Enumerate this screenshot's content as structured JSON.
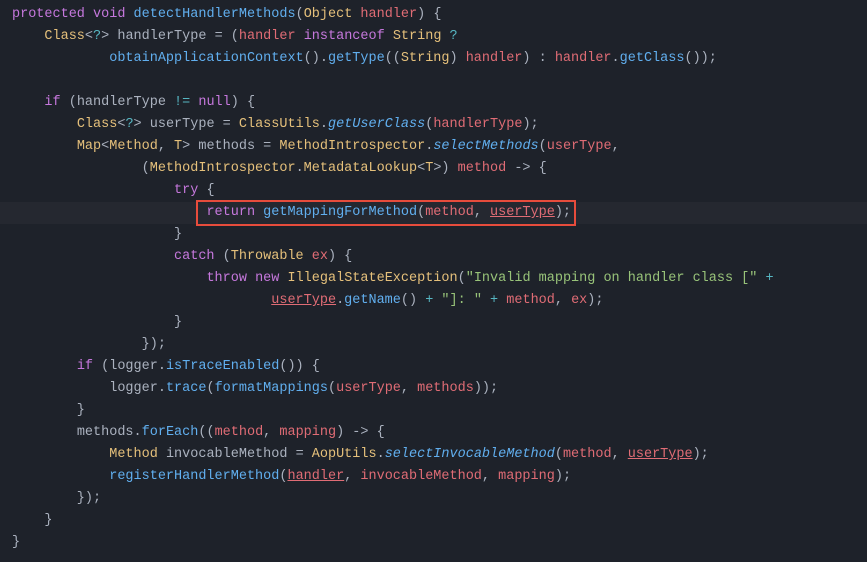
{
  "code": {
    "l1": {
      "kw1": "protected",
      "kw2": "void",
      "method": "detectHandlerMethods",
      "type": "Object",
      "param": "handler",
      "tail": ") {"
    },
    "l2": {
      "indent": "    ",
      "type1": "Class",
      "punc1": "<",
      "op": "?",
      "punc2": "> ",
      "var": "handlerType",
      "eq": " = (",
      "param": "handler",
      "kw": " instanceof ",
      "type2": "String",
      "tail": " ?"
    },
    "l3": {
      "indent": "            ",
      "call": "obtainApplicationContext",
      "p1": "().",
      "call2": "getType",
      "p2": "((",
      "type": "String",
      "p3": ") ",
      "param": "handler",
      "p4": ") : ",
      "param2": "handler",
      "p5": ".",
      "call3": "getClass",
      "tail": "());"
    },
    "l5": {
      "indent": "    ",
      "kw": "if",
      "p1": " (",
      "var": "handlerType",
      "op": " != ",
      "kw2": "null",
      "tail": ") {"
    },
    "l6": {
      "indent": "        ",
      "type1": "Class",
      "p1": "<",
      "op": "?",
      "p2": "> ",
      "var": "userType",
      "eq": " = ",
      "type2": "ClassUtils",
      "p3": ".",
      "ital": "getUserClass",
      "p4": "(",
      "param": "handlerType",
      "tail": ");"
    },
    "l7": {
      "indent": "        ",
      "type1": "Map",
      "p1": "<",
      "type2": "Method",
      "p2": ", ",
      "type3": "T",
      "p3": "> ",
      "var": "methods",
      "eq": " = ",
      "type4": "MethodIntrospector",
      "p4": ".",
      "ital": "selectMethods",
      "p5": "(",
      "param": "userType",
      "tail": ","
    },
    "l8": {
      "indent": "                (",
      "type1": "MethodIntrospector",
      "p1": ".",
      "type2": "MetadataLookup",
      "p2": "<",
      "type3": "T",
      "p3": ">) ",
      "param": "method",
      "arrow": " -> {",
      "tail": ""
    },
    "l9": {
      "indent": "                    ",
      "kw": "try",
      "tail": " {"
    },
    "l10": {
      "indent": "                        ",
      "kw": "return",
      "sp": " ",
      "call": "getMappingForMethod",
      "p1": "(",
      "param1": "method",
      "p2": ", ",
      "uvar": "userType",
      "tail": ");"
    },
    "l11": {
      "indent": "                    }",
      "tail": ""
    },
    "l12": {
      "indent": "                    ",
      "kw": "catch",
      "p1": " (",
      "type": "Throwable",
      "sp": " ",
      "param": "ex",
      "tail": ") {"
    },
    "l13": {
      "indent": "                        ",
      "kw1": "throw",
      "sp": " ",
      "kw2": "new",
      "sp2": " ",
      "type": "IllegalStateException",
      "p1": "(",
      "str": "\"Invalid mapping on handler class [\"",
      "op": " +",
      "tail": ""
    },
    "l14": {
      "indent": "                                ",
      "uvar": "userType",
      "p1": ".",
      "call": "getName",
      "p2": "() ",
      "op1": "+",
      "sp": " ",
      "str": "\"]: \"",
      "sp2": " ",
      "op2": "+",
      "sp3": " ",
      "param1": "method",
      "p3": ", ",
      "param2": "ex",
      "tail": ");"
    },
    "l15": {
      "indent": "                    }",
      "tail": ""
    },
    "l16": {
      "indent": "                });",
      "tail": ""
    },
    "l17": {
      "indent": "        ",
      "kw": "if",
      "p1": " (",
      "var": "logger",
      "p2": ".",
      "call": "isTraceEnabled",
      "tail": "()) {"
    },
    "l18": {
      "indent": "            ",
      "var": "logger",
      "p1": ".",
      "call1": "trace",
      "p2": "(",
      "call2": "formatMappings",
      "p3": "(",
      "param1": "userType",
      "p4": ", ",
      "param2": "methods",
      "tail": "));"
    },
    "l19": {
      "indent": "        }",
      "tail": ""
    },
    "l20": {
      "indent": "        ",
      "var": "methods",
      "p1": ".",
      "call": "forEach",
      "p2": "((",
      "param1": "method",
      "p3": ", ",
      "param2": "mapping",
      "arrow": ") -> {",
      "tail": ""
    },
    "l21": {
      "indent": "            ",
      "type1": "Method",
      "sp": " ",
      "var": "invocableMethod",
      "eq": " = ",
      "type2": "AopUtils",
      "p1": ".",
      "ital": "selectInvocableMethod",
      "p2": "(",
      "param1": "method",
      "p3": ", ",
      "uvar": "userType",
      "tail": ");"
    },
    "l22": {
      "indent": "            ",
      "call": "registerHandlerMethod",
      "p1": "(",
      "uvar": "handler",
      "p2": ", ",
      "param1": "invocableMethod",
      "p3": ", ",
      "param2": "mapping",
      "tail": ");"
    },
    "l23": {
      "indent": "        });",
      "tail": ""
    },
    "l24": {
      "indent": "    }",
      "tail": ""
    },
    "l25": {
      "indent": "}",
      "tail": ""
    }
  }
}
